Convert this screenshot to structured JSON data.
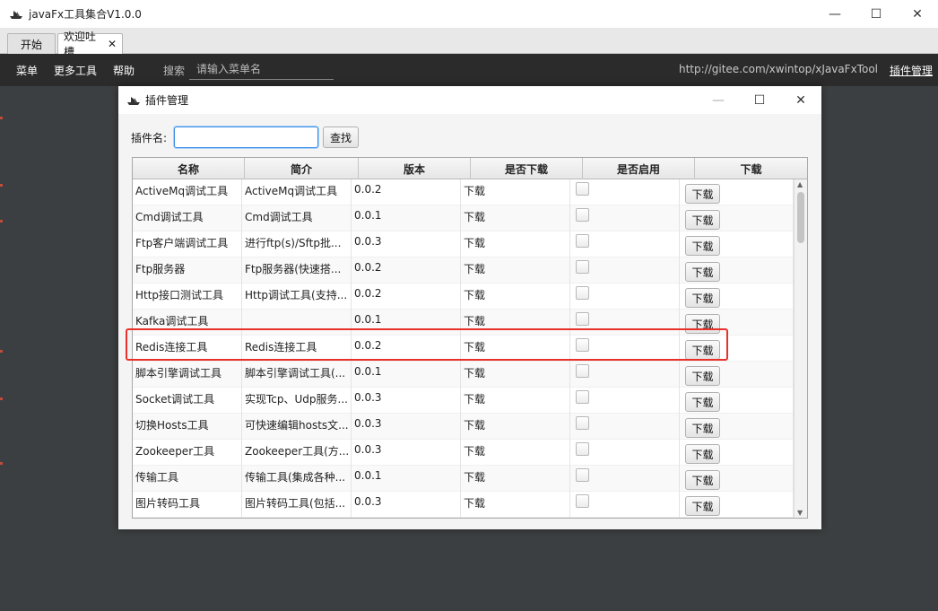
{
  "window": {
    "title": "javaFx工具集合V1.0.0",
    "min_icon": "—",
    "max_icon": "☐",
    "close_icon": "✕"
  },
  "tabs": [
    {
      "label": "开始"
    },
    {
      "label": "欢迎吐槽",
      "close": "✕"
    }
  ],
  "menubar": {
    "items": [
      "菜单",
      "更多工具",
      "帮助"
    ],
    "search_label": "搜索",
    "search_placeholder": "请输入菜单名",
    "url": "http://gitee.com/xwintop/xJavaFxTool",
    "plugin_link": "插件管理"
  },
  "dialog": {
    "title": "插件管理",
    "min_icon": "—",
    "max_icon": "☐",
    "close_icon": "✕",
    "filter_label": "插件名:",
    "filter_value": "",
    "find_button": "查找",
    "columns": [
      "名称",
      "简介",
      "版本",
      "是否下载",
      "是否启用",
      "下载"
    ],
    "rows": [
      {
        "name": "ActiveMq调试工具",
        "desc": "ActiveMq调试工具",
        "version": "0.0.2",
        "downloaded": "下载",
        "button": "下载"
      },
      {
        "name": "Cmd调试工具",
        "desc": "Cmd调试工具",
        "version": "0.0.1",
        "downloaded": "下载",
        "button": "下载"
      },
      {
        "name": "Ftp客户端调试工具",
        "desc": "进行ftp(s)/Sftp批...",
        "version": "0.0.3",
        "downloaded": "下载",
        "button": "下载"
      },
      {
        "name": "Ftp服务器",
        "desc": "Ftp服务器(快速搭...",
        "version": "0.0.2",
        "downloaded": "下载",
        "button": "下载"
      },
      {
        "name": "Http接口测试工具",
        "desc": "Http调试工具(支持...",
        "version": "0.0.2",
        "downloaded": "下载",
        "button": "下载"
      },
      {
        "name": "Kafka调试工具",
        "desc": "",
        "version": "0.0.1",
        "downloaded": "下载",
        "button": "下载"
      },
      {
        "name": "Redis连接工具",
        "desc": "Redis连接工具",
        "version": "0.0.2",
        "downloaded": "下载",
        "button": "下载"
      },
      {
        "name": "脚本引擎调试工具",
        "desc": "脚本引擎调试工具(...",
        "version": "0.0.1",
        "downloaded": "下载",
        "button": "下载"
      },
      {
        "name": "Socket调试工具",
        "desc": "实现Tcp、Udp服务...",
        "version": "0.0.3",
        "downloaded": "下载",
        "button": "下载"
      },
      {
        "name": "切换Hosts工具",
        "desc": "可快速编辑hosts文...",
        "version": "0.0.3",
        "downloaded": "下载",
        "button": "下载"
      },
      {
        "name": "Zookeeper工具",
        "desc": "Zookeeper工具(方...",
        "version": "0.0.3",
        "downloaded": "下载",
        "button": "下载"
      },
      {
        "name": "传输工具",
        "desc": "传输工具(集成各种...",
        "version": "0.0.1",
        "downloaded": "下载",
        "button": "下载"
      },
      {
        "name": "图片转码工具",
        "desc": "图片转码工具(包括...",
        "version": "0.0.3",
        "downloaded": "下载",
        "button": "下载"
      }
    ]
  }
}
